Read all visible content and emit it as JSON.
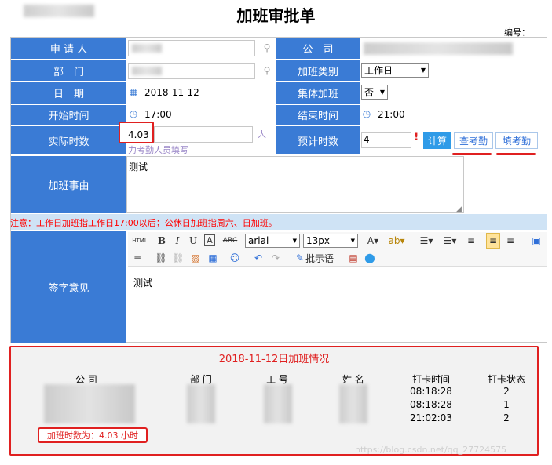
{
  "page": {
    "title": "加班审批单",
    "number_label": "编号："
  },
  "form": {
    "applicant_label": "申 请 人",
    "company_label": "公　司",
    "department_label": "部　门",
    "ot_type_label": "加班类别",
    "ot_type_value": "工作日",
    "date_label": "日　期",
    "date_value": "2018-11-12",
    "group_ot_label": "集体加班",
    "group_ot_value": "否",
    "start_label": "开始时间",
    "start_value": "17:00",
    "end_label": "结束时间",
    "end_value": "21:00",
    "actual_label": "实际时数",
    "actual_value": "4.03",
    "actual_unit": "人",
    "actual_hint": "力考勤人员填写",
    "est_label": "预计时数",
    "est_value": "4",
    "est_required": "!",
    "calc_btn": "计算",
    "check_btn": "查考勤",
    "fill_btn": "填考勤",
    "reason_label": "加班事由",
    "reason_value": "测试",
    "notice": "注意：工作日加班指工作日17:00以后；公休日加班指周六、日加班。",
    "sign_label": "签字意见",
    "sign_value": "测试"
  },
  "toolbar": {
    "html": "HTML",
    "font": "arial",
    "size": "13px",
    "approve": "批示语"
  },
  "attendance": {
    "title": "2018-11-12日加班情况",
    "headers": [
      "公 司",
      "部 门",
      "工 号",
      "姓 名",
      "打卡时间",
      "打卡状态"
    ],
    "times": [
      "08:18:28",
      "08:18:28",
      "21:02:03"
    ],
    "statuses": [
      "2",
      "1",
      "2"
    ],
    "summary": "加班时数为：4.03 小时"
  },
  "watermark": "https://blog.csdn.net/qq_27724575",
  "colors": {
    "accent": "#3a7bd5",
    "highlight": "#e02020",
    "notice": "#ff0000"
  }
}
